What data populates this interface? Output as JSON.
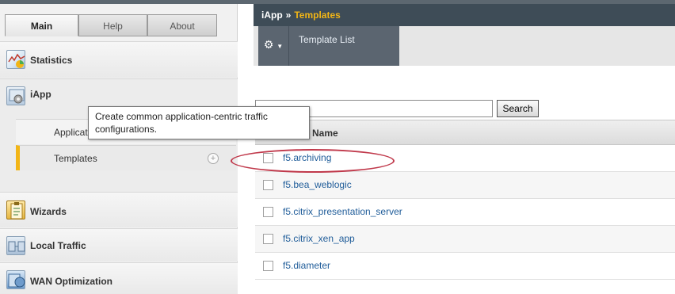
{
  "tabs": {
    "main": "Main",
    "help": "Help",
    "about": "About"
  },
  "sidebar": {
    "statistics": {
      "label": "Statistics",
      "icon": "chart-icon"
    },
    "iapp": {
      "label": "iApp",
      "icon": "iapp-icon",
      "items": [
        {
          "label": "Application Services"
        },
        {
          "label": "Templates",
          "selected": true,
          "plus": "+"
        }
      ]
    },
    "wizards": {
      "label": "Wizards",
      "icon": "clipboard-icon"
    },
    "local_traffic": {
      "label": "Local Traffic",
      "icon": "network-icon"
    },
    "wan": {
      "label": "WAN Optimization",
      "icon": "globe-icon"
    }
  },
  "tooltip": {
    "text": "Create common application-centric traffic configurations."
  },
  "breadcrumb": {
    "root": "iApp",
    "separator": "»",
    "current": "Templates"
  },
  "subnav": {
    "gear": "⚙",
    "caret": "▼",
    "tab": "Template List"
  },
  "search": {
    "value": "",
    "button": "Search"
  },
  "table": {
    "name_header": "Name",
    "rows": [
      {
        "name": "f5.archiving"
      },
      {
        "name": "f5.bea_weblogic"
      },
      {
        "name": "f5.citrix_presentation_server"
      },
      {
        "name": "f5.citrix_xen_app"
      },
      {
        "name": "f5.diameter"
      }
    ]
  },
  "colors": {
    "accent": "#f2b516",
    "header_bar": "#3e4c57",
    "link": "#1f5c99",
    "annotation": "#c0394b"
  }
}
